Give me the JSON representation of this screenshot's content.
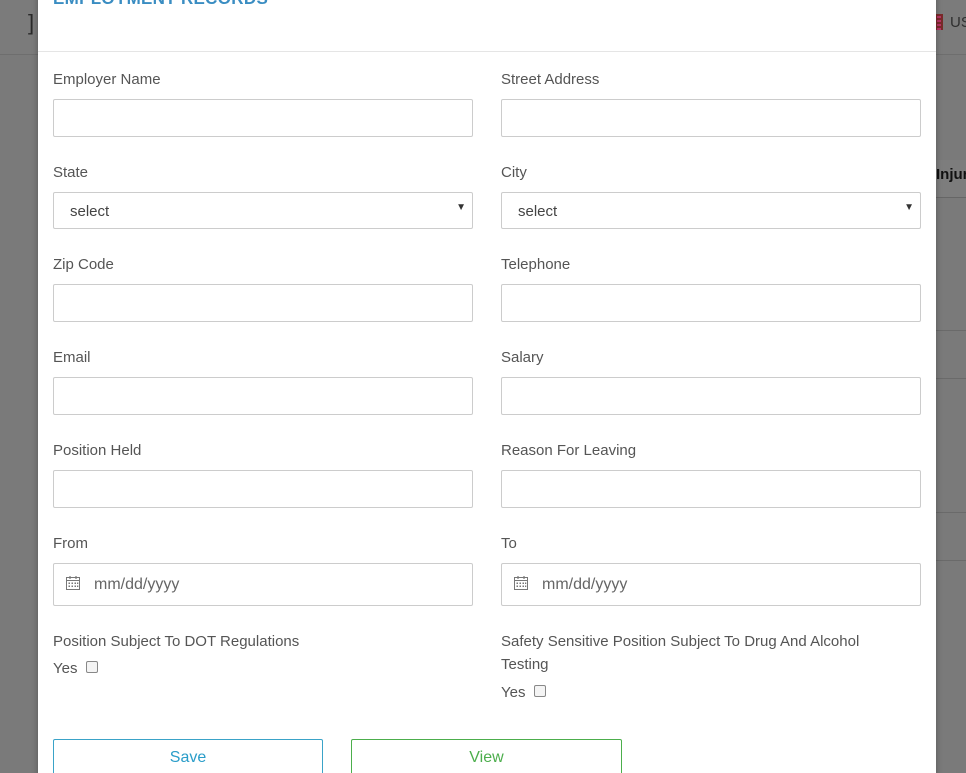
{
  "background": {
    "header_glyph": "]",
    "locale": "US",
    "column_header": "Injur"
  },
  "modal": {
    "title": "EMPLOYMENT RECORDS",
    "close_symbol": "×"
  },
  "form": {
    "employer_name": {
      "label": "Employer Name",
      "value": ""
    },
    "street_address": {
      "label": "Street Address",
      "value": ""
    },
    "state": {
      "label": "State",
      "selected": "select"
    },
    "city": {
      "label": "City",
      "selected": "select"
    },
    "zip_code": {
      "label": "Zip Code",
      "value": ""
    },
    "telephone": {
      "label": "Telephone",
      "value": ""
    },
    "email": {
      "label": "Email",
      "value": ""
    },
    "salary": {
      "label": "Salary",
      "value": ""
    },
    "position_held": {
      "label": "Position Held",
      "value": ""
    },
    "reason_for_leaving": {
      "label": "Reason For Leaving",
      "value": ""
    },
    "from": {
      "label": "From",
      "placeholder": "mm/dd/yyyy"
    },
    "to": {
      "label": "To",
      "placeholder": "mm/dd/yyyy"
    },
    "dot_regulations": {
      "label": "Position Subject To DOT Regulations",
      "option": "Yes",
      "checked": false
    },
    "safety_sensitive": {
      "label": "Safety Sensitive Position Subject To Drug And Alcohol Testing",
      "option": "Yes",
      "checked": false
    }
  },
  "buttons": {
    "save": "Save",
    "view": "View"
  },
  "colors": {
    "title": "#3a8dc2",
    "save": "#2a9dc9",
    "view": "#4cae4c",
    "backdrop": "#7a7a7a"
  }
}
